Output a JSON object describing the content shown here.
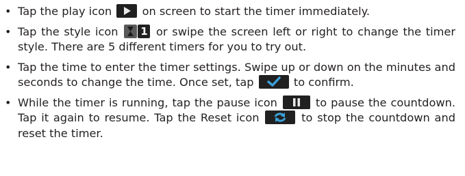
{
  "bullets": [
    {
      "before": "Tap the play icon",
      "icon": "play-icon",
      "after": "on screen to start the timer immediately."
    },
    {
      "before": "Tap the style icon",
      "icon": "hourglass-style-icon",
      "icon_digit": "1",
      "after": "or swipe the screen left or right to change the timer style. There are 5 different timers for you to try out."
    },
    {
      "before": "Tap the time to enter the timer settings. Swipe up or down on the minutes and seconds to change the time. Once set, tap",
      "icon": "checkmark-icon",
      "after": "to confirm."
    },
    {
      "before": "While the timer is running, tap the pause icon",
      "icon": "pause-icon",
      "middle": "to pause the countdown. Tap it again to resume. Tap the Reset icon",
      "icon2": "reset-icon",
      "after": "to stop the countdown and reset the timer."
    }
  ],
  "colors": {
    "text": "#231f20",
    "icon_bg": "#202020",
    "check": "#3aa0d8",
    "reset": "#3aa0d8"
  }
}
